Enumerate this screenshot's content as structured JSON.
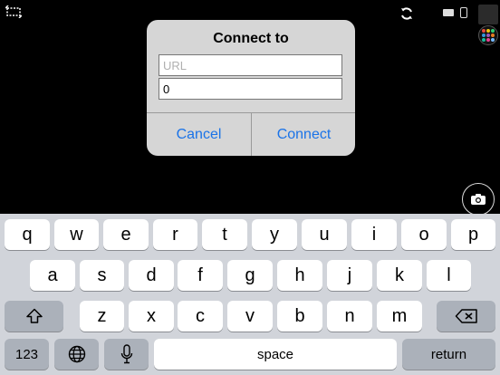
{
  "dialog": {
    "title": "Connect to",
    "url_placeholder": "URL",
    "url_value": "",
    "port_value": "0",
    "cancel_label": "Cancel",
    "connect_label": "Connect"
  },
  "keyboard": {
    "row1": [
      "q",
      "w",
      "e",
      "r",
      "t",
      "y",
      "u",
      "i",
      "o",
      "p"
    ],
    "row2": [
      "a",
      "s",
      "d",
      "f",
      "g",
      "h",
      "j",
      "k",
      "l"
    ],
    "row3": [
      "z",
      "x",
      "c",
      "v",
      "b",
      "n",
      "m"
    ],
    "numbers_label": "123",
    "space_label": "space",
    "return_label": "return"
  },
  "colors": {
    "accent": "#1a73e8",
    "keyboard_bg": "#d1d4da",
    "function_key": "#abb1ba"
  },
  "icons": {
    "top_left": "screen-resize-icon",
    "sync": "sync-icon",
    "camera": "camera-icon",
    "shift": "shift-icon",
    "backspace": "backspace-icon",
    "globe": "globe-icon",
    "mic": "microphone-icon"
  }
}
